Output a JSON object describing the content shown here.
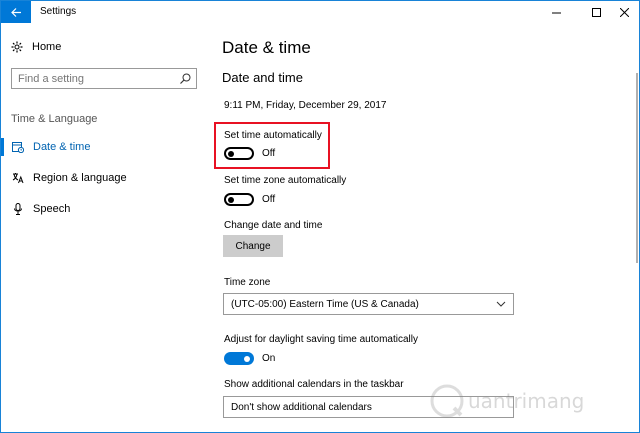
{
  "window": {
    "title": "Settings"
  },
  "sidebar": {
    "home_label": "Home",
    "search_placeholder": "Find a setting",
    "section_label": "Time & Language",
    "items": [
      {
        "label": "Date & time",
        "icon": "calendar-clock-icon",
        "active": true
      },
      {
        "label": "Region & language",
        "icon": "region-language-icon",
        "active": false
      },
      {
        "label": "Speech",
        "icon": "microphone-icon",
        "active": false
      }
    ]
  },
  "main": {
    "page_title": "Date & time",
    "section_title": "Date and time",
    "current_time": "9:11 PM, Friday, December 29, 2017",
    "set_time_auto": {
      "label": "Set time automatically",
      "state": "Off",
      "on": false
    },
    "set_timezone_auto": {
      "label": "Set time zone automatically",
      "state": "Off",
      "on": false
    },
    "change_date": {
      "label": "Change date and time",
      "button": "Change"
    },
    "time_zone": {
      "label": "Time zone",
      "value": "(UTC-05:00) Eastern Time (US & Canada)"
    },
    "daylight": {
      "label": "Adjust for daylight saving time automatically",
      "state": "On",
      "on": true
    },
    "calendars": {
      "label": "Show additional calendars in the taskbar",
      "value": "Don't show additional calendars"
    }
  },
  "watermark": {
    "text": "uantrimang"
  },
  "colors": {
    "accent": "#0078d7",
    "highlight_border": "#e81123",
    "button_bg": "#cccccc"
  }
}
